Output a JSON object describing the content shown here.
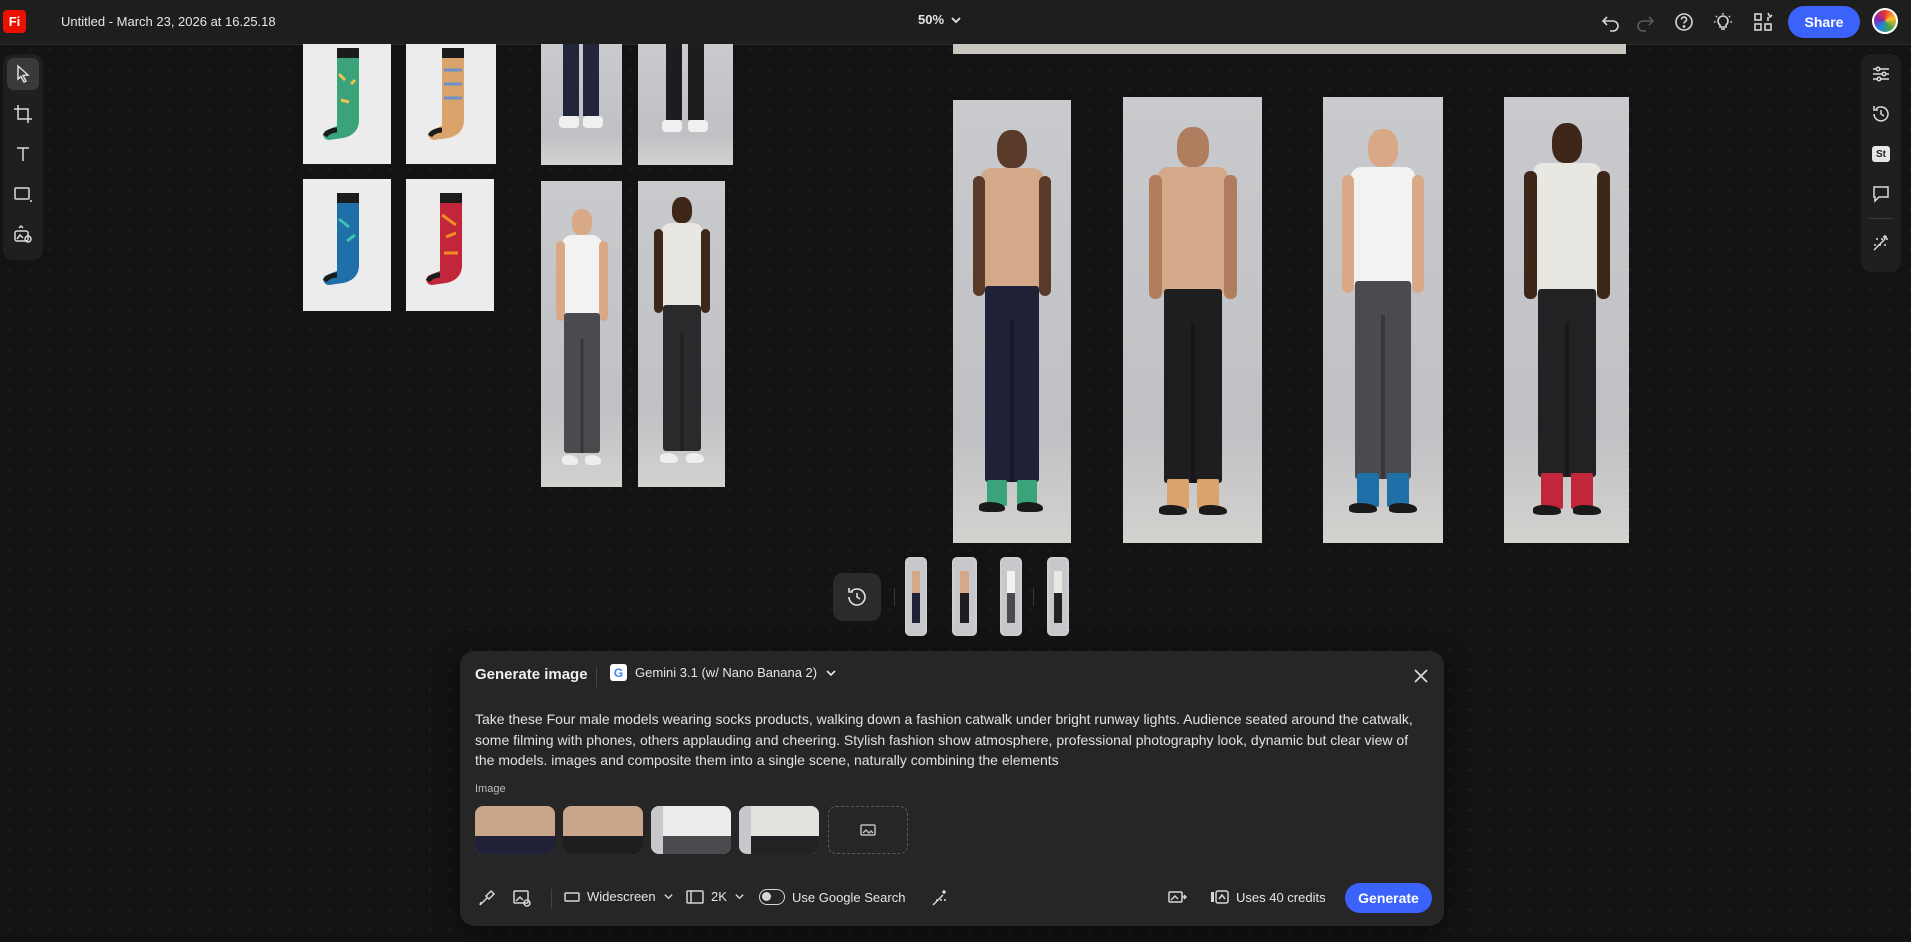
{
  "app": {
    "logo": "Fi",
    "document_title": "Untitled - March 23, 2026 at 16.25.18"
  },
  "header": {
    "zoom": "50%",
    "share_label": "Share",
    "icons": [
      "undo-icon",
      "redo-icon",
      "help-icon",
      "lightbulb-icon",
      "apps-icon"
    ]
  },
  "left_toolbar": [
    "select-tool",
    "artboard-tool",
    "text-tool",
    "shape-tool",
    "generate-image-tool"
  ],
  "right_toolbar": [
    "adjust-icon",
    "history-icon",
    "stock-icon",
    "comment-icon",
    "generate-settings-icon"
  ],
  "right_toolbar_stock_label": "St",
  "canvas": {
    "sock_colors": [
      "#3aa37a",
      "#d9a36b",
      "#1f6fa8",
      "#c2263a"
    ],
    "model_shirt_colors": [
      "#d3a98a",
      "#d3a98a",
      "#f2f2f2",
      "#e9e7e2"
    ],
    "model_skin_colors": [
      "#5a3b2a",
      "#b07d5f",
      "#d9a987",
      "#3e2619"
    ]
  },
  "panel": {
    "title": "Generate image",
    "model_name": "Gemini 3.1 (w/ Nano Banana 2)",
    "model_logo": "G",
    "prompt": "Take these Four male models wearing socks products, walking down a fashion catwalk under bright runway lights. Audience seated around the catwalk, some filming with phones, others applauding and cheering. Stylish fashion show atmosphere, professional photography look, dynamic but clear view of the models. images and composite them into a single scene, naturally combining the elements",
    "image_label": "Image",
    "aspect_ratio": "Widescreen",
    "resolution": "2K",
    "google_search_label": "Use Google Search",
    "credits_label": "Uses 40 credits",
    "generate_label": "Generate"
  }
}
